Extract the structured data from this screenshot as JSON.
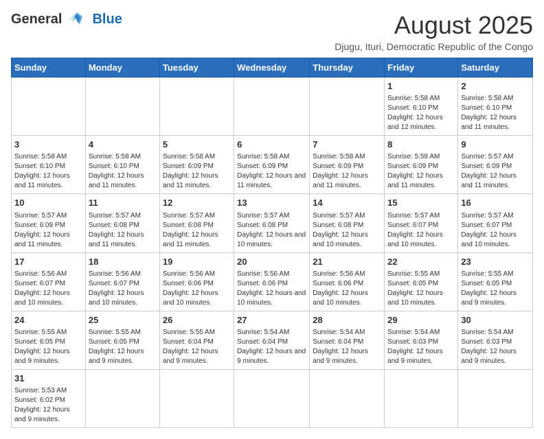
{
  "header": {
    "logo_general": "General",
    "logo_blue": "Blue",
    "main_title": "August 2025",
    "subtitle": "Djugu, Ituri, Democratic Republic of the Congo"
  },
  "calendar": {
    "days_of_week": [
      "Sunday",
      "Monday",
      "Tuesday",
      "Wednesday",
      "Thursday",
      "Friday",
      "Saturday"
    ],
    "weeks": [
      [
        {
          "day": "",
          "info": ""
        },
        {
          "day": "",
          "info": ""
        },
        {
          "day": "",
          "info": ""
        },
        {
          "day": "",
          "info": ""
        },
        {
          "day": "",
          "info": ""
        },
        {
          "day": "1",
          "info": "Sunrise: 5:58 AM\nSunset: 6:10 PM\nDaylight: 12 hours and 12 minutes."
        },
        {
          "day": "2",
          "info": "Sunrise: 5:58 AM\nSunset: 6:10 PM\nDaylight: 12 hours and 11 minutes."
        }
      ],
      [
        {
          "day": "3",
          "info": "Sunrise: 5:58 AM\nSunset: 6:10 PM\nDaylight: 12 hours and 11 minutes."
        },
        {
          "day": "4",
          "info": "Sunrise: 5:58 AM\nSunset: 6:10 PM\nDaylight: 12 hours and 11 minutes."
        },
        {
          "day": "5",
          "info": "Sunrise: 5:58 AM\nSunset: 6:09 PM\nDaylight: 12 hours and 11 minutes."
        },
        {
          "day": "6",
          "info": "Sunrise: 5:58 AM\nSunset: 6:09 PM\nDaylight: 12 hours and 11 minutes."
        },
        {
          "day": "7",
          "info": "Sunrise: 5:58 AM\nSunset: 6:09 PM\nDaylight: 12 hours and 11 minutes."
        },
        {
          "day": "8",
          "info": "Sunrise: 5:58 AM\nSunset: 6:09 PM\nDaylight: 12 hours and 11 minutes."
        },
        {
          "day": "9",
          "info": "Sunrise: 5:57 AM\nSunset: 6:09 PM\nDaylight: 12 hours and 11 minutes."
        }
      ],
      [
        {
          "day": "10",
          "info": "Sunrise: 5:57 AM\nSunset: 6:09 PM\nDaylight: 12 hours and 11 minutes."
        },
        {
          "day": "11",
          "info": "Sunrise: 5:57 AM\nSunset: 6:08 PM\nDaylight: 12 hours and 11 minutes."
        },
        {
          "day": "12",
          "info": "Sunrise: 5:57 AM\nSunset: 6:08 PM\nDaylight: 12 hours and 11 minutes."
        },
        {
          "day": "13",
          "info": "Sunrise: 5:57 AM\nSunset: 6:08 PM\nDaylight: 12 hours and 10 minutes."
        },
        {
          "day": "14",
          "info": "Sunrise: 5:57 AM\nSunset: 6:08 PM\nDaylight: 12 hours and 10 minutes."
        },
        {
          "day": "15",
          "info": "Sunrise: 5:57 AM\nSunset: 6:07 PM\nDaylight: 12 hours and 10 minutes."
        },
        {
          "day": "16",
          "info": "Sunrise: 5:57 AM\nSunset: 6:07 PM\nDaylight: 12 hours and 10 minutes."
        }
      ],
      [
        {
          "day": "17",
          "info": "Sunrise: 5:56 AM\nSunset: 6:07 PM\nDaylight: 12 hours and 10 minutes."
        },
        {
          "day": "18",
          "info": "Sunrise: 5:56 AM\nSunset: 6:07 PM\nDaylight: 12 hours and 10 minutes."
        },
        {
          "day": "19",
          "info": "Sunrise: 5:56 AM\nSunset: 6:06 PM\nDaylight: 12 hours and 10 minutes."
        },
        {
          "day": "20",
          "info": "Sunrise: 5:56 AM\nSunset: 6:06 PM\nDaylight: 12 hours and 10 minutes."
        },
        {
          "day": "21",
          "info": "Sunrise: 5:56 AM\nSunset: 6:06 PM\nDaylight: 12 hours and 10 minutes."
        },
        {
          "day": "22",
          "info": "Sunrise: 5:55 AM\nSunset: 6:05 PM\nDaylight: 12 hours and 10 minutes."
        },
        {
          "day": "23",
          "info": "Sunrise: 5:55 AM\nSunset: 6:05 PM\nDaylight: 12 hours and 9 minutes."
        }
      ],
      [
        {
          "day": "24",
          "info": "Sunrise: 5:55 AM\nSunset: 6:05 PM\nDaylight: 12 hours and 9 minutes."
        },
        {
          "day": "25",
          "info": "Sunrise: 5:55 AM\nSunset: 6:05 PM\nDaylight: 12 hours and 9 minutes."
        },
        {
          "day": "26",
          "info": "Sunrise: 5:55 AM\nSunset: 6:04 PM\nDaylight: 12 hours and 9 minutes."
        },
        {
          "day": "27",
          "info": "Sunrise: 5:54 AM\nSunset: 6:04 PM\nDaylight: 12 hours and 9 minutes."
        },
        {
          "day": "28",
          "info": "Sunrise: 5:54 AM\nSunset: 6:04 PM\nDaylight: 12 hours and 9 minutes."
        },
        {
          "day": "29",
          "info": "Sunrise: 5:54 AM\nSunset: 6:03 PM\nDaylight: 12 hours and 9 minutes."
        },
        {
          "day": "30",
          "info": "Sunrise: 5:54 AM\nSunset: 6:03 PM\nDaylight: 12 hours and 9 minutes."
        }
      ],
      [
        {
          "day": "31",
          "info": "Sunrise: 5:53 AM\nSunset: 6:02 PM\nDaylight: 12 hours and 9 minutes."
        },
        {
          "day": "",
          "info": ""
        },
        {
          "day": "",
          "info": ""
        },
        {
          "day": "",
          "info": ""
        },
        {
          "day": "",
          "info": ""
        },
        {
          "day": "",
          "info": ""
        },
        {
          "day": "",
          "info": ""
        }
      ]
    ]
  }
}
